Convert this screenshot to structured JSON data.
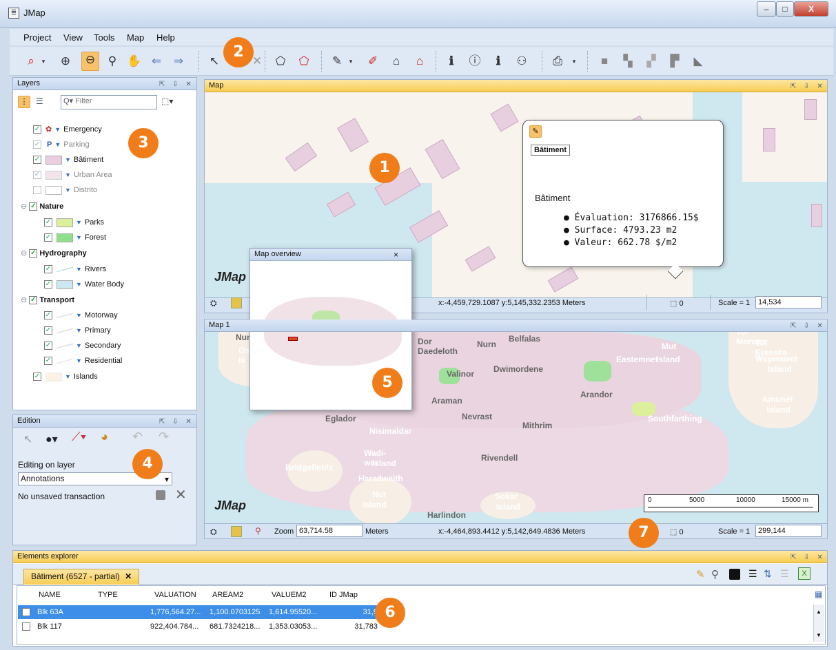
{
  "window": {
    "title": "JMap",
    "min": "–",
    "max": "□",
    "close": "X"
  },
  "menu": [
    "Project",
    "View",
    "Tools",
    "Map",
    "Help"
  ],
  "layers_panel": {
    "title": "Layers",
    "filter_placeholder": "Filter",
    "items": [
      {
        "label": "Emergency",
        "checked": true,
        "dim": false
      },
      {
        "label": "Parking",
        "checked": true,
        "dim": true
      },
      {
        "label": "Bâtiment",
        "checked": true,
        "dim": false
      },
      {
        "label": "Urban Area",
        "checked": true,
        "dim": true
      },
      {
        "label": "Distrito",
        "checked": false,
        "dim": true
      }
    ],
    "groups": [
      {
        "label": "Nature",
        "children": [
          "Parks",
          "Forest"
        ]
      },
      {
        "label": "Hydrography",
        "children": [
          "Rivers",
          "Water Body"
        ]
      },
      {
        "label": "Transport",
        "children": [
          "Motorway",
          "Primary",
          "Secondary",
          "Residential"
        ]
      }
    ],
    "islands": "Islands"
  },
  "edition_panel": {
    "title": "Edition",
    "editing_label": "Editing on layer",
    "layer_value": "Annotations",
    "transaction_status": "No unsaved transaction"
  },
  "map_top": {
    "title": "Map",
    "coords": "x:-4,459,729.1087  y:5,145,332.2353 Meters",
    "selection_count": "0",
    "scale_label": "Scale = 1",
    "scale_value": "14,534",
    "watermark": "JMap",
    "popup": {
      "tab": "Bâtiment",
      "heading": "Bâtiment",
      "lines": [
        "Évaluation: 3176866.15$",
        "Surface: 4793.23 m2",
        "Valeur: 662.78 $/m2"
      ]
    }
  },
  "map_bottom": {
    "title": "Map 1",
    "zoom_label": "Zoom",
    "zoom_value": "63,714.58",
    "zoom_unit": "Meters",
    "coords": "x:-4,464,893.4412  y:5,142,649.4836 Meters",
    "selection_count": "0",
    "scale_label": "Scale = 1",
    "scale_value": "299,144",
    "watermark": "JMap",
    "scalebar": [
      "0",
      "5000",
      "10000",
      "15000 m"
    ],
    "place_labels": [
      "Dor Daedeloth",
      "Nurn",
      "Belfalas",
      "Mut",
      "Tol Eressëa",
      "Dwimordene",
      "Eastemnet",
      "Island",
      "Wepwawet",
      "Island",
      "Valinor",
      "Arandor",
      "Amunet",
      "Island",
      "Araman",
      "Nevrast",
      "Southfarthing",
      "Eglador",
      "Nisimaldar",
      "Mithrim",
      "Wadi-wer",
      "Island",
      "Rivendell",
      "Bridgefields",
      "Haradwaith",
      "Nut",
      "Island",
      "Sokar",
      "Island",
      "Harlindon",
      "Num",
      "Os",
      "Is",
      "Tol Morwen"
    ]
  },
  "overview": {
    "title": "Map overview",
    "close": "×"
  },
  "elements_explorer": {
    "title": "Elements explorer",
    "tab": "Bâtiment (6527 - partial)",
    "columns": [
      "NAME",
      "TYPE",
      "VALUATION",
      "AREAM2",
      "VALUEM2",
      "ID JMap"
    ],
    "rows": [
      {
        "name": "Blk 63A",
        "type": "",
        "valuation": "1,776,564.27...",
        "aream2": "1,100.0703125",
        "valuem2": "1,614.95520...",
        "id": "31,9",
        "selected": true
      },
      {
        "name": "Blk 117",
        "type": "",
        "valuation": "922,404.784...",
        "aream2": "681.7324218...",
        "valuem2": "1,353.03053...",
        "id": "31,783",
        "selected": false
      }
    ]
  },
  "callouts": [
    "1",
    "2",
    "3",
    "4",
    "5",
    "6",
    "7"
  ],
  "colors": {
    "accent": "#f07d1a",
    "active_header": "#f7cc52",
    "selection": "#3d8ee8"
  }
}
